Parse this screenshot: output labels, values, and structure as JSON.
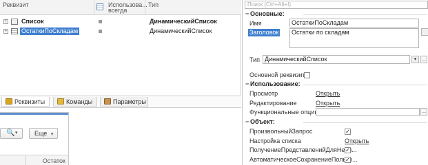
{
  "attributes": {
    "columns": {
      "requisite": "Реквизит",
      "always_use": "Использова... всегда",
      "type": "Тип"
    },
    "rows": [
      {
        "name": "Список",
        "type": "ДинамическийСписок",
        "bold": true,
        "expander": "+"
      },
      {
        "name": "ОстаткиПоСкладам",
        "type": "ДинамическийСписок",
        "bold": false,
        "expander": "+"
      }
    ],
    "tabs": {
      "requisites": "Реквизиты",
      "commands": "Команды",
      "parameters": "Параметры"
    }
  },
  "preview": {
    "search_icon": "🔍",
    "search_caret": "▾",
    "more_label": "Еще",
    "more_caret": "▾",
    "column_header": "Остаток"
  },
  "properties": {
    "search_placeholder": "Поиск (Ctrl+Alt+I)",
    "sections": {
      "basic": "Основные:",
      "usage": "Использование:",
      "object": "Объект:"
    },
    "name_label": "Имя",
    "name_value": "ОстаткиПоСкладам",
    "title_label": "Заголовок",
    "title_value": "Остатки по складам",
    "type_label": "Тип",
    "type_value": "ДинамическийСписок",
    "main_attr_label": "Основной реквизит",
    "view_label": "Просмотр",
    "view_link": "Открыть",
    "edit_label": "Редактирование",
    "edit_link": "Открыть",
    "func_options_label": "Функциональные опции",
    "custom_query_label": "ПроизвольныйЗапрос",
    "list_settings_label": "Настройка списка",
    "list_settings_link": "Открыть",
    "get_presentations_label": "ПолучениеПредставленийДляНеви...",
    "autosave_label": "АвтоматическоеСохранениеПользо...",
    "check_mark": "✓",
    "minus": "−",
    "dots": "...",
    "dropdown": "▾"
  }
}
